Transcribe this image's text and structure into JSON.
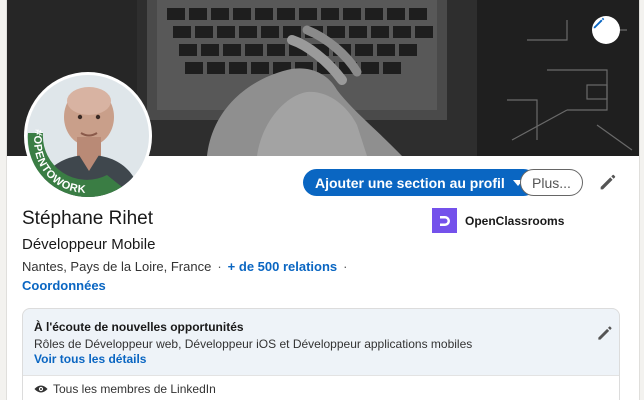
{
  "profile": {
    "name": "Stéphane Rihet",
    "headline": "Développeur Mobile",
    "location": "Nantes, Pays de la Loire, France",
    "separator": "·",
    "connections": "+ de 500 relations",
    "contact_link": "Coordonnées",
    "badge_text": "#OPENTOWORK"
  },
  "company": {
    "name": "OpenClassrooms",
    "logo_color": "#7451eb"
  },
  "actions": {
    "add_section": "Ajouter une section au profil",
    "more": "Plus..."
  },
  "open_to_work": {
    "title": "À l'écoute de nouvelles opportunités",
    "roles": "Rôles de Développeur web, Développeur iOS et Développeur applications mobiles",
    "details_link": "Voir tous les détails",
    "visibility": "Tous les membres de LinkedIn"
  },
  "colors": {
    "primary": "#0a66c2",
    "badge_green": "#3a7d44"
  },
  "icons": {
    "edit": "pencil-icon",
    "visibility": "eye-icon",
    "dropdown": "caret-down-icon"
  }
}
